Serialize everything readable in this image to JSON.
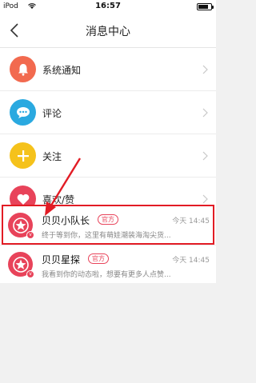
{
  "status_bar": {
    "carrier": "iPod",
    "time": "16:57",
    "battery_level_percent": 65
  },
  "nav": {
    "title": "消息中心"
  },
  "menu": [
    {
      "label": "系统通知",
      "icon": "bell-icon",
      "color": "#f26a4f"
    },
    {
      "label": "评论",
      "icon": "comment-icon",
      "color": "#2aa9e0"
    },
    {
      "label": "关注",
      "icon": "plus-icon",
      "color": "#f5c21b"
    },
    {
      "label": "喜欢/赞",
      "icon": "heart-icon",
      "color": "#e8435a"
    }
  ],
  "messages": [
    {
      "name": "贝贝小队长",
      "tag": "官方",
      "time": "今天 14:45",
      "preview": "终于等到你，这里有萌娃潮装海淘尖货...",
      "icon": "star-icon",
      "color": "#e8435a"
    },
    {
      "name": "贝贝星探",
      "tag": "官方",
      "time": "今天 14:45",
      "preview": "我看到你的动态啦，想要有更多人点赞...",
      "icon": "star-icon",
      "color": "#e8435a"
    }
  ],
  "annotation": {
    "box_color": "#e21c25",
    "arrow_color": "#e21c25"
  }
}
